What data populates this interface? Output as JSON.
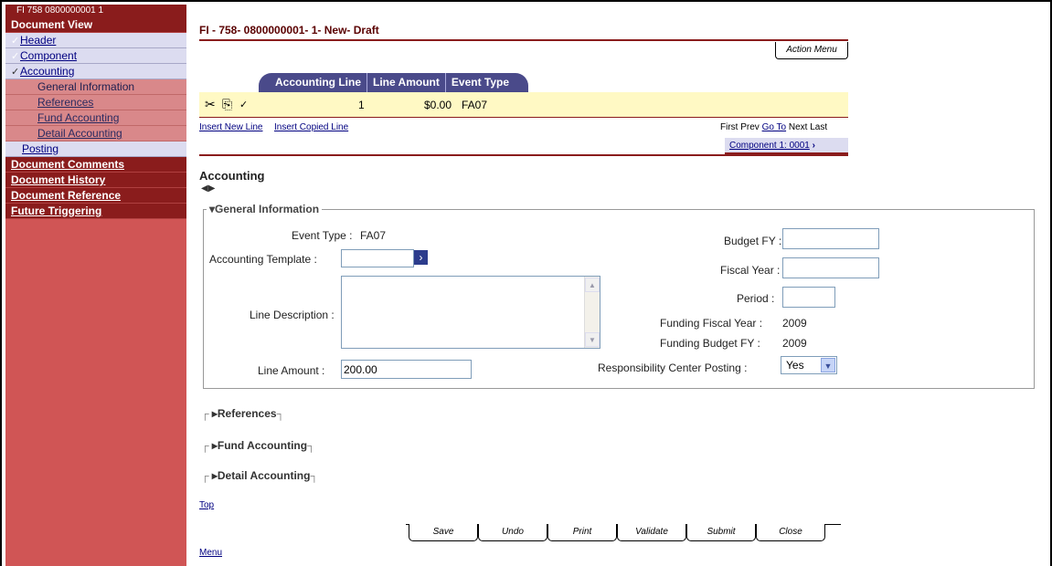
{
  "sidebar": {
    "doc_id": "FI 758 0800000001 1",
    "document_view": "Document View",
    "items": [
      {
        "label": "Header"
      },
      {
        "label": "Component"
      },
      {
        "label": "Accounting"
      }
    ],
    "sub_items": [
      {
        "label": "General Information"
      },
      {
        "label": "References"
      },
      {
        "label": "Fund Accounting"
      },
      {
        "label": "Detail Accounting"
      }
    ],
    "posting": "Posting",
    "sections": [
      {
        "label": "Document Comments"
      },
      {
        "label": "Document History"
      },
      {
        "label": "Document Reference"
      },
      {
        "label": "Future Triggering"
      }
    ]
  },
  "main": {
    "title": "FI - 758- 0800000001- 1- New- Draft",
    "action_menu": "Action Menu",
    "grid": {
      "columns": [
        "Accounting Line",
        "Line Amount",
        "Event Type"
      ],
      "rows": [
        {
          "line": "1",
          "amount": "$0.00",
          "event": "FA07"
        }
      ]
    },
    "insert_new_line": "Insert New Line",
    "insert_copied_line": "Insert Copied Line",
    "nav_first": "First",
    "nav_prev": "Prev",
    "nav_goto": "Go To",
    "nav_next": "Next",
    "nav_last": "Last",
    "component_link": "Component 1: 0001",
    "section_title": "Accounting",
    "general_info": {
      "legend": "General Information",
      "event_type_label": "Event Type :",
      "event_type_value": "FA07",
      "accounting_template_label": "Accounting Template :",
      "accounting_template_value": "",
      "line_description_label": "Line Description :",
      "line_description_value": "",
      "line_amount_label": "Line Amount :",
      "line_amount_value": "200.00",
      "budget_fy_label": "Budget FY :",
      "budget_fy_value": "",
      "fiscal_year_label": "Fiscal Year :",
      "fiscal_year_value": "",
      "period_label": "Period :",
      "period_value": "",
      "funding_fiscal_year_label": "Funding Fiscal Year :",
      "funding_fiscal_year_value": "2009",
      "funding_budget_fy_label": "Funding Budget FY :",
      "funding_budget_fy_value": "2009",
      "resp_center_label": "Responsibility Center Posting :",
      "resp_center_value": "Yes"
    },
    "collapsed_sections": [
      {
        "label": "References"
      },
      {
        "label": "Fund Accounting"
      },
      {
        "label": "Detail Accounting"
      }
    ],
    "top_link": "Top",
    "menu_link": "Menu",
    "buttons": [
      "Save",
      "Undo",
      "Print",
      "Validate",
      "Submit",
      "Close"
    ]
  }
}
